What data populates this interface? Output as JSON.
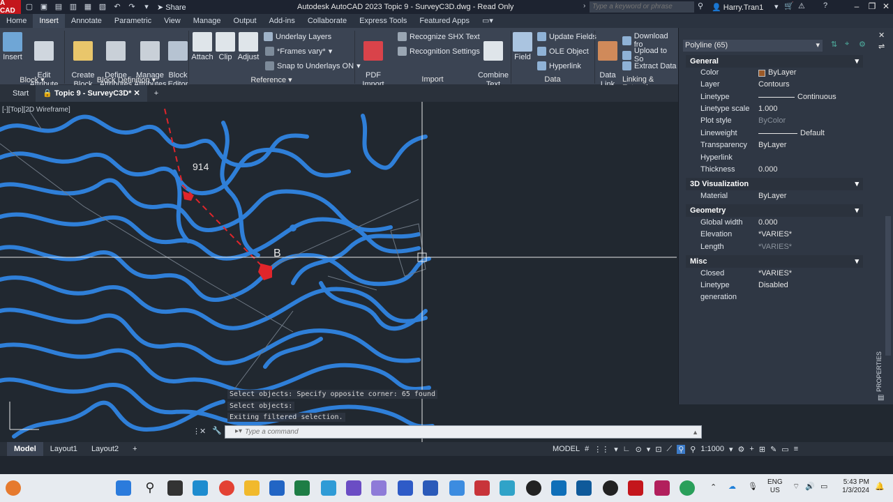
{
  "titlebar": {
    "logo": "A CAD",
    "share": "Share",
    "title": "Autodesk AutoCAD 2023    Topic 9 - SurveyC3D.dwg - Read Only",
    "search_placeholder": "Type a keyword or phrase",
    "user": "Harry.Tran1"
  },
  "tabs": [
    "Home",
    "Insert",
    "Annotate",
    "Parametric",
    "View",
    "Manage",
    "Output",
    "Add-ins",
    "Collaborate",
    "Express Tools",
    "Featured Apps"
  ],
  "ribbon": {
    "insert": "Insert",
    "edit_attribute": "Edit\nAttribute",
    "create_block": "Create\nBlock",
    "define_attributes": "Define\nAttributes",
    "manage_attributes": "Manage\nAttributes",
    "block_editor": "Block\nEditor",
    "attach": "Attach",
    "clip": "Clip",
    "adjust": "Adjust",
    "underlay_layers": "Underlay Layers",
    "frames_vary": "*Frames vary*",
    "snap_underlays": "Snap to Underlays ON",
    "pdf_import": "PDF\nImport",
    "recognize_shx": "Recognize SHX Text",
    "recognition_settings": "Recognition Settings",
    "combine_text": "Combine\nText",
    "field": "Field",
    "update_fields": "Update Fields",
    "ole_object": "OLE Object",
    "hyperlink": "Hyperlink",
    "data_link": "Data\nLink",
    "download_from": "Download fro",
    "upload_to": "Upload to So",
    "extract_data": "Extract  Data",
    "panels": {
      "block": "Block",
      "block_definition": "Block Definition",
      "reference": "Reference",
      "import": "Import",
      "data": "Data",
      "linking": "Linking & Extracti"
    }
  },
  "doctabs": {
    "start": "Start",
    "active": "Topic 9 - SurveyC3D*"
  },
  "canvas": {
    "viewport_label": "[-][Top][2D Wireframe]",
    "text_914": "914",
    "text_b": "B"
  },
  "command": {
    "history": [
      "Select objects: Specify opposite corner: 65 found",
      "Select objects:",
      "Exiting filtered selection."
    ],
    "placeholder": "Type a command"
  },
  "layouts": [
    "Model",
    "Layout1",
    "Layout2"
  ],
  "status": {
    "model": "MODEL",
    "scale": "1:1000"
  },
  "properties": {
    "selection": "Polyline (65)",
    "vertical_title": "PROPERTIES",
    "sections": {
      "general": "General",
      "visualization": "3D Visualization",
      "geometry": "Geometry",
      "misc": "Misc"
    },
    "general": [
      {
        "key": "Color",
        "value": "ByLayer"
      },
      {
        "key": "Layer",
        "value": "Contours"
      },
      {
        "key": "Linetype",
        "value": "Continuous"
      },
      {
        "key": "Linetype scale",
        "value": "1.000"
      },
      {
        "key": "Plot style",
        "value": "ByColor"
      },
      {
        "key": "Lineweight",
        "value": "Default"
      },
      {
        "key": "Transparency",
        "value": "ByLayer"
      },
      {
        "key": "Hyperlink",
        "value": ""
      },
      {
        "key": "Thickness",
        "value": "0.000"
      }
    ],
    "visualization": [
      {
        "key": "Material",
        "value": "ByLayer"
      }
    ],
    "geometry": [
      {
        "key": "Global width",
        "value": "0.000"
      },
      {
        "key": "Elevation",
        "value": "*VARIES*"
      },
      {
        "key": "Length",
        "value": "*VARIES*"
      }
    ],
    "misc": [
      {
        "key": "Closed",
        "value": "*VARIES*"
      },
      {
        "key": "Linetype generation",
        "value": "Disabled"
      }
    ]
  },
  "taskbar": {
    "lang": "ENG",
    "region": "US",
    "time": "5:43 PM",
    "date": "1/3/2024"
  },
  "colors": {
    "contour": "#2f7fd8",
    "accent": "#c4161c",
    "ribbon": "#3b4453"
  }
}
